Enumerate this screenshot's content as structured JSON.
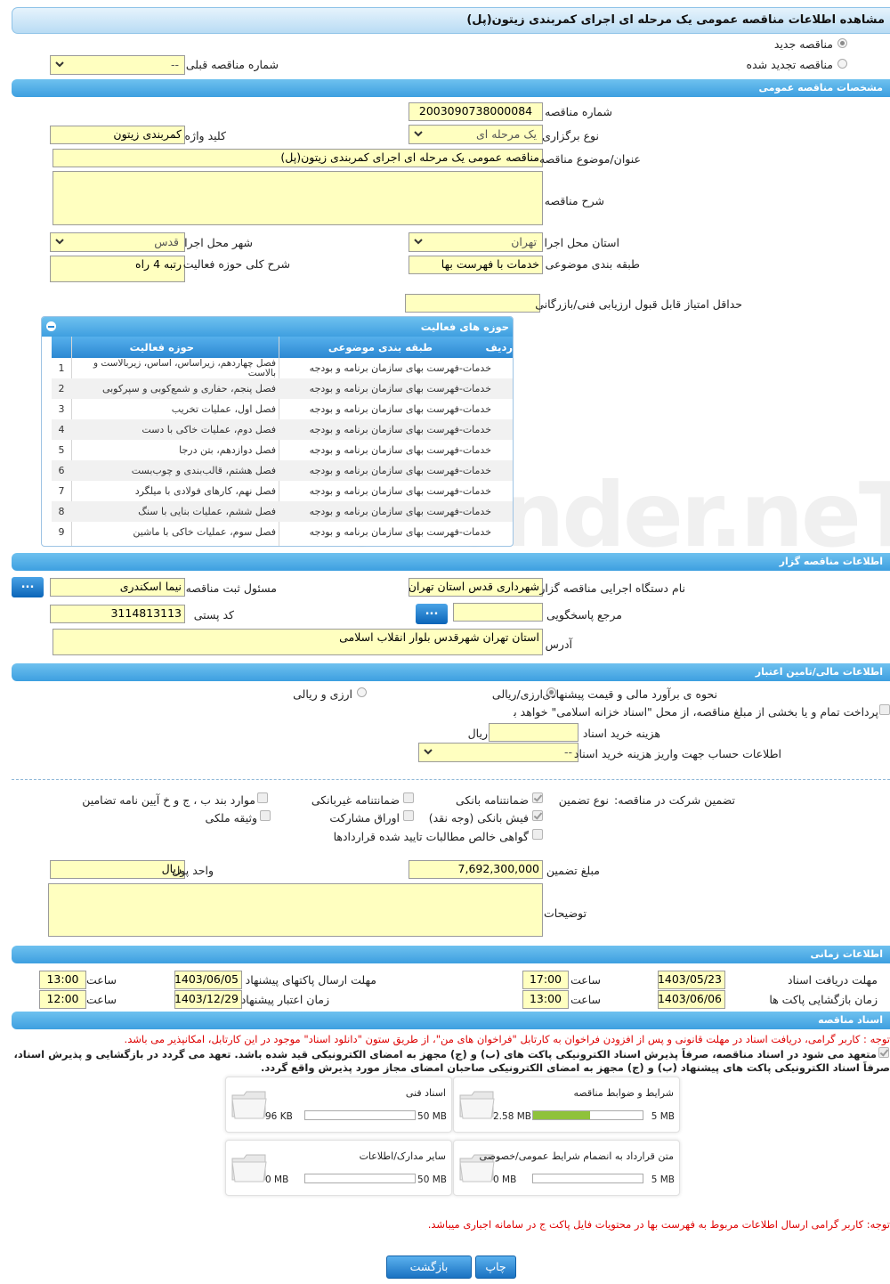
{
  "page_title": "مشاهده اطلاعات مناقصه عمومی یک مرحله ای اجرای کمربندی زیتون(پل)",
  "tender_type": {
    "new_label": "مناقصه جدید",
    "renewed_label": "مناقصه تجدید شده",
    "previous_label": "شماره مناقصه قبلی",
    "previous_value": "--"
  },
  "general": {
    "section": "مشخصات مناقصه عمومی",
    "number_label": "شماره مناقصه",
    "number": "2003090738000084",
    "holding_type_label": "نوع برگزاری",
    "holding_type": "یک مرحله ای",
    "keyword_label": "کلید واژه",
    "keyword": "کمربندی زیتون",
    "subject_label": "عنوان/موضوع مناقصه",
    "subject": "مناقصه عمومی یک مرحله ای اجرای کمربندی زیتون(پل)",
    "description_label": "شرح مناقصه",
    "description": "",
    "province_label": "استان محل اجرا",
    "province": "تهران",
    "city_label": "شهر محل اجرا",
    "city": "قدس",
    "category_label": "طبقه بندی موضوعی",
    "category": "خدمات با فهرست بها",
    "scope_label": "شرح کلی حوزه فعالیت",
    "scope": "رتبه 4 راه",
    "min_score_label": "حداقل امتیاز قابل قبول ارزیابی فنی/بازرگانی",
    "min_score": ""
  },
  "activity_panel": {
    "title": "حوزه های فعالیت",
    "col_row": "ردیف",
    "col_category": "طبقه بندی موضوعی",
    "col_field": "حوزه فعالیت",
    "rows": [
      {
        "n": "1",
        "category": "خدمات-فهرست بهای سازمان برنامه و بودجه",
        "field": "فصل چهاردهم، زیراساس، اساس، زیربالاست  و",
        "field2": "بالاست"
      },
      {
        "n": "2",
        "category": "خدمات-فهرست بهای سازمان برنامه و بودجه",
        "field": "فصل پنجم، حفاری و شمع‌کوبی و سپرکوبی"
      },
      {
        "n": "3",
        "category": "خدمات-فهرست بهای سازمان برنامه و بودجه",
        "field": "فصل اول، عملیات تخریب"
      },
      {
        "n": "4",
        "category": "خدمات-فهرست بهای سازمان برنامه و بودجه",
        "field": "فصل دوم، عملیات خاکی با دست"
      },
      {
        "n": "5",
        "category": "خدمات-فهرست بهای سازمان برنامه و بودجه",
        "field": "فصل دوازدهم، بتن درجا"
      },
      {
        "n": "6",
        "category": "خدمات-فهرست بهای سازمان برنامه و بودجه",
        "field": "فصل هشتم، قالب‌بندی و چوب‌بست"
      },
      {
        "n": "7",
        "category": "خدمات-فهرست بهای سازمان برنامه و بودجه",
        "field": "فصل نهم، کارهای فولادی با میلگرد"
      },
      {
        "n": "8",
        "category": "خدمات-فهرست بهای سازمان برنامه و بودجه",
        "field": "فصل ششم، عملیات بنایی با سنگ"
      },
      {
        "n": "9",
        "category": "خدمات-فهرست بهای سازمان برنامه و بودجه",
        "field": "فصل سوم، عملیات خاکی با ماشین"
      }
    ]
  },
  "organizer": {
    "section": "اطلاعات مناقصه گزار",
    "agency_label": "نام دستگاه اجرایی مناقصه گزار",
    "agency": "شهرداری قدس استان تهران",
    "registrar_label": "مسئول ثبت مناقصه",
    "registrar": "نیما اسکندری",
    "reference_label": "مرجع پاسخگویی",
    "reference": "",
    "postal_label": "کد پستی",
    "postal": "3114813113",
    "address_label": "آدرس",
    "address": "استان تهران شهرقدس بلوار انقلاب اسلامی",
    "dots": "..."
  },
  "financial": {
    "section": "اطلاعات مالی/تامین اعتبار",
    "estimate_label": "نحوه ی برآورد مالی و قیمت پیشنهادی",
    "opt1": "ارزی/ریالی",
    "opt2": "ارزی و ریالی",
    "islamic_note": "پرداخت تمام و یا بخشی از مبلغ مناقصه، از محل \"اسناد خزانه اسلامی\" خواهد بود.",
    "doc_fee_label": "هزینه خرید اسناد",
    "doc_fee": "",
    "rial": "ریال",
    "account_label": "اطلاعات حساب جهت واریز هزینه خرید اسناد",
    "account": "--"
  },
  "guarantee": {
    "title": "تضمین شرکت در مناقصه:",
    "type_label": "نوع تضمین",
    "bank_guarantee": "ضمانتنامه بانکی",
    "nonbank_guarantee": "ضمانتنامه غیربانکی",
    "other_items": "موارد بند ب ، ج و خ آیین نامه تضامین",
    "bank_receipt": "فیش بانکی (وجه نقد)",
    "bonds": "اوراق مشارکت",
    "property": "وثیقه ملکی",
    "claims": "گواهی خالص مطالبات تایید شده قراردادها",
    "amount_label": "مبلغ تضمین",
    "amount": "7,692,300,000",
    "currency_label": "واحد پول",
    "currency": "ریال",
    "notes_label": "توضیحات",
    "notes": ""
  },
  "timing": {
    "section": "اطلاعات زمانی",
    "doc_deadline_label": "مهلت دریافت اسناد",
    "doc_deadline": "1403/05/23",
    "doc_time": "17:00",
    "submit_deadline_label": "مهلت ارسال پاکتهای پیشنهاد",
    "submit_deadline": "1403/06/05",
    "submit_time": "13:00",
    "opening_label": "زمان بازگشایی پاکت ها",
    "opening": "1403/06/06",
    "opening_time": "13:00",
    "validity_label": "زمان اعتبار پیشنهاد",
    "validity": "1403/12/29",
    "validity_time": "12:00",
    "time_label": "ساعت"
  },
  "documents": {
    "section": "اسناد مناقصه",
    "note1": "توجه : کاربر گرامی، دریافت اسناد در مهلت قانونی و پس از افزودن فراخوان به کارتابل \"فراخوان های من\"، از طریق ستون \"دانلود اسناد\" موجود در این کارتابل، امکانپذیر می باشد.",
    "note2": "متعهد می شود در اسناد مناقصه، صرفاً پذیرش اسناد الکترونیکی پاکت های (ب) و (ج) مجهز به امضای الکترونیکی قید شده باشد. تعهد می گردد در بازگشایی و پذیرش اسناد،",
    "note3": "صرفاً اسناد الکترونیکی پاکت های پیشنهاد (ب) و (ج) مجهز به امضای الکترونیکی صاحبان امضای مجاز مورد پذیرش واقع گردد.",
    "files": [
      {
        "name": "شرایط و ضوابط مناقصه",
        "max": "5 MB",
        "size": "2.58 MB",
        "fill": 0.52
      },
      {
        "name": "اسناد فنی",
        "max": "50 MB",
        "size": "96 KB",
        "fill": 0.0
      },
      {
        "name": "متن قرارداد به انضمام شرایط عمومی/خصوصی",
        "max": "5 MB",
        "size": "0 MB",
        "fill": 0.0
      },
      {
        "name": "سایر مدارک/اطلاعات",
        "max": "50 MB",
        "size": "0 MB",
        "fill": 0.0
      }
    ],
    "note4": "توجه: کاربر گرامی ارسال اطلاعات مربوط به فهرست بها در محتویات فایل پاکت ج در سامانه اجباری میباشد."
  },
  "buttons": {
    "print": "چاپ",
    "back": "بازگشت"
  },
  "watermark": "AriaTender.neT"
}
